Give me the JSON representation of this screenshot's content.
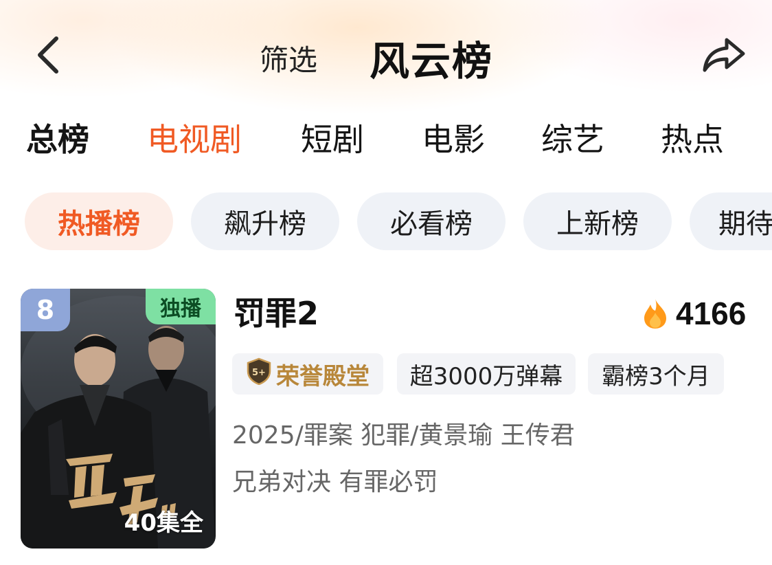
{
  "header": {
    "back_icon": "chevron-left-icon",
    "filter_label": "筛选",
    "title": "风云榜",
    "share_icon": "share-arrow-icon"
  },
  "category_tabs": [
    {
      "label": "总榜",
      "active": false
    },
    {
      "label": "电视剧",
      "active": true
    },
    {
      "label": "短剧",
      "active": false
    },
    {
      "label": "电影",
      "active": false
    },
    {
      "label": "综艺",
      "active": false
    },
    {
      "label": "热点",
      "active": false
    }
  ],
  "chips": [
    {
      "label": "热播榜",
      "active": true
    },
    {
      "label": "飙升榜",
      "active": false
    },
    {
      "label": "必看榜",
      "active": false
    },
    {
      "label": "上新榜",
      "active": false
    },
    {
      "label": "期待",
      "active": false
    }
  ],
  "item": {
    "rank": "8",
    "exclusive_badge": "独播",
    "poster_text": "40集全",
    "title": "罚罪2",
    "heat_icon": "flame-icon",
    "heat_value": "4166",
    "tags": [
      {
        "label": "荣誉殿堂",
        "icon": "honor-shield-icon",
        "icon_text": "5+"
      },
      {
        "label": "超3000万弹幕"
      },
      {
        "label": "霸榜3个月"
      }
    ],
    "meta_line": "2025/罪案 犯罪/黄景瑜 王传君",
    "slogan": "兄弟对决 有罪必罚"
  },
  "colors": {
    "accent": "#f05a24",
    "chip_active_bg": "#fdeee8",
    "chip_bg": "#eff2f7",
    "rank_badge": "#8fa6d8",
    "exclusive_badge": "#7ee0a3",
    "honor_gold": "#b8873a"
  }
}
